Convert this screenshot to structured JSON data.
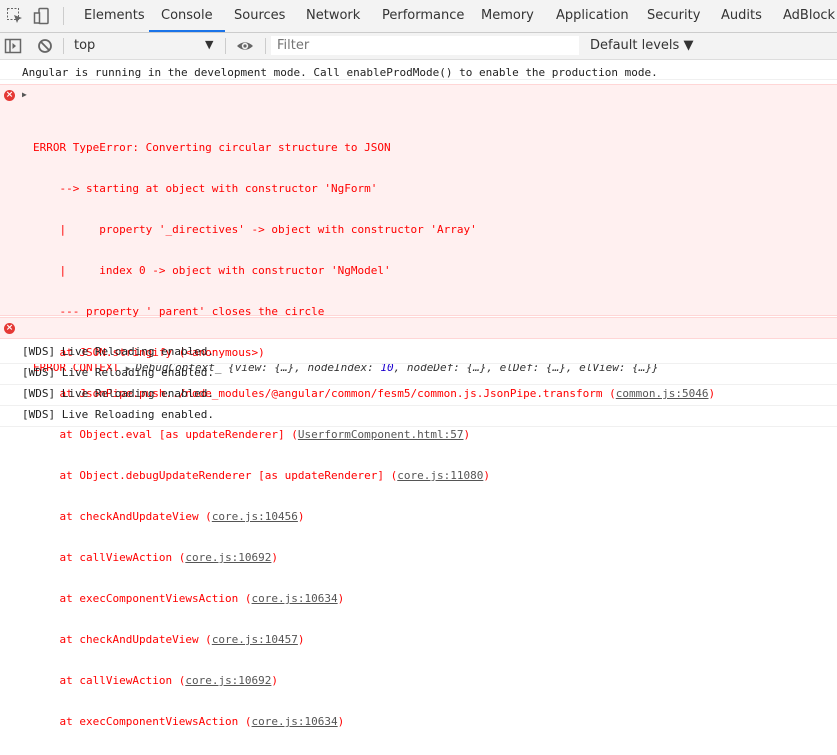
{
  "tabs": [
    {
      "label": "Elements",
      "active": false
    },
    {
      "label": "Console",
      "active": true
    },
    {
      "label": "Sources",
      "active": false
    },
    {
      "label": "Network",
      "active": false
    },
    {
      "label": "Performance",
      "active": false
    },
    {
      "label": "Memory",
      "active": false
    },
    {
      "label": "Application",
      "active": false
    },
    {
      "label": "Security",
      "active": false
    },
    {
      "label": "Audits",
      "active": false
    },
    {
      "label": "AdBlock",
      "active": false
    }
  ],
  "toolbar": {
    "context": "top",
    "filter_placeholder": "Filter",
    "levels": "Default levels ▼"
  },
  "console": {
    "info_message": "Angular is running in the development mode. Call enableProdMode() to enable the production mode.",
    "error1": {
      "title": "ERROR TypeError: Converting circular structure to JSON",
      "detail": [
        "    --> starting at object with constructor 'NgForm'",
        "    |     property '_directives' -> object with constructor 'Array'",
        "    |     index 0 -> object with constructor 'NgModel'",
        "    --- property '_parent' closes the circle",
        "    at JSON.stringify (<anonymous>)"
      ],
      "stack": [
        {
          "text": "    at JsonPipe.push../node_modules/@angular/common/fesm5/common.js.JsonPipe.transform (",
          "link": "common.js:5046",
          "end": ")"
        },
        {
          "text": "    at Object.eval [as updateRenderer] (",
          "link": "UserformComponent.html:57",
          "end": ")"
        },
        {
          "text": "    at Object.debugUpdateRenderer [as updateRenderer] (",
          "link": "core.js:11080",
          "end": ")"
        },
        {
          "text": "    at checkAndUpdateView (",
          "link": "core.js:10456",
          "end": ")"
        },
        {
          "text": "    at callViewAction (",
          "link": "core.js:10692",
          "end": ")"
        },
        {
          "text": "    at execComponentViewsAction (",
          "link": "core.js:10634",
          "end": ")"
        },
        {
          "text": "    at checkAndUpdateView (",
          "link": "core.js:10457",
          "end": ")"
        },
        {
          "text": "    at callViewAction (",
          "link": "core.js:10692",
          "end": ")"
        },
        {
          "text": "    at execComponentViewsAction (",
          "link": "core.js:10634",
          "end": ")"
        }
      ]
    },
    "error2": {
      "prefix": "ERROR CONTEXT ",
      "object": "DebugContext_ {view: {…}, nodeIndex: ",
      "number": "10",
      "rest": ", nodeDef: {…}, elDef: {…}, elView: {…}}"
    },
    "wds": [
      "[WDS] Live Reloading enabled.",
      "[WDS] Live Reloading enabled.",
      "[WDS] Live Reloading enabled.",
      "[WDS] Live Reloading enabled."
    ]
  },
  "colors": {
    "error_bg": "#fff0f0",
    "error_text": "#ff0000",
    "active_tab_underline": "#1a73e8"
  },
  "icons": [
    "inspect-element-icon",
    "device-toolbar-icon",
    "sidebar-toggle-icon",
    "clear-console-icon",
    "live-expression-eye-icon",
    "error-circle-icon"
  ]
}
